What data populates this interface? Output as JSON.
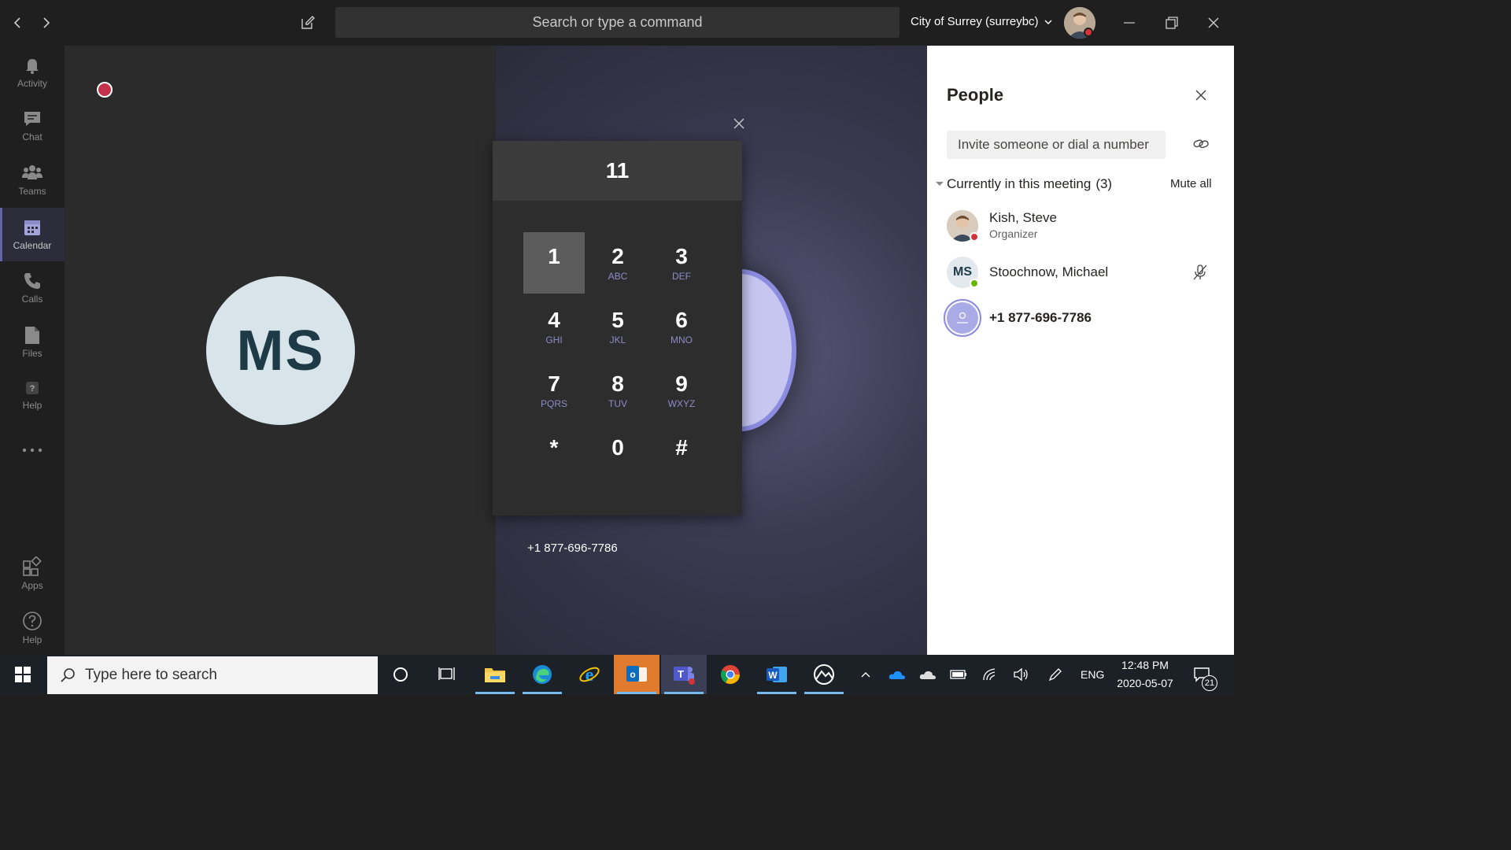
{
  "titlebar": {
    "search_placeholder": "Search or type a command",
    "org_name": "City of Surrey (surreybc)"
  },
  "rail": {
    "items": [
      {
        "label": "Activity",
        "icon": "bell-icon"
      },
      {
        "label": "Chat",
        "icon": "chat-icon"
      },
      {
        "label": "Teams",
        "icon": "teams-icon"
      },
      {
        "label": "Calendar",
        "icon": "calendar-icon",
        "active": true
      },
      {
        "label": "Calls",
        "icon": "phone-icon"
      },
      {
        "label": "Files",
        "icon": "file-icon"
      },
      {
        "label": "Help",
        "icon": "help-icon"
      },
      {
        "label": "Apps",
        "icon": "apps-icon"
      },
      {
        "label": "Help",
        "icon": "help-circle-icon"
      }
    ]
  },
  "stage": {
    "participant_initials": "MS",
    "dialed_number_label": "+1 877-696-7786"
  },
  "dialpad": {
    "display": "11",
    "keys": [
      {
        "digit": "1",
        "letters": "",
        "selected": true
      },
      {
        "digit": "2",
        "letters": "ABC"
      },
      {
        "digit": "3",
        "letters": "DEF"
      },
      {
        "digit": "4",
        "letters": "GHI"
      },
      {
        "digit": "5",
        "letters": "JKL"
      },
      {
        "digit": "6",
        "letters": "MNO"
      },
      {
        "digit": "7",
        "letters": "PQRS"
      },
      {
        "digit": "8",
        "letters": "TUV"
      },
      {
        "digit": "9",
        "letters": "WXYZ"
      },
      {
        "digit": "*",
        "letters": ""
      },
      {
        "digit": "0",
        "letters": ""
      },
      {
        "digit": "#",
        "letters": ""
      }
    ]
  },
  "people": {
    "title": "People",
    "invite_placeholder": "Invite someone or dial a number",
    "section_label": "Currently in this meeting",
    "section_count": "(3)",
    "mute_all": "Mute all",
    "participants": [
      {
        "name": "Kish, Steve",
        "role": "Organizer"
      },
      {
        "name": "Stoochnow, Michael",
        "initials": "MS"
      },
      {
        "name": "+1 877-696-7786"
      }
    ]
  },
  "taskbar": {
    "search_placeholder": "Type here to search",
    "language": "ENG",
    "time": "12:48 PM",
    "date": "2020-05-07",
    "notification_count": "21"
  },
  "colors": {
    "accent": "#6264a7",
    "presence_busy": "#d13438",
    "presence_available": "#6bb700"
  }
}
